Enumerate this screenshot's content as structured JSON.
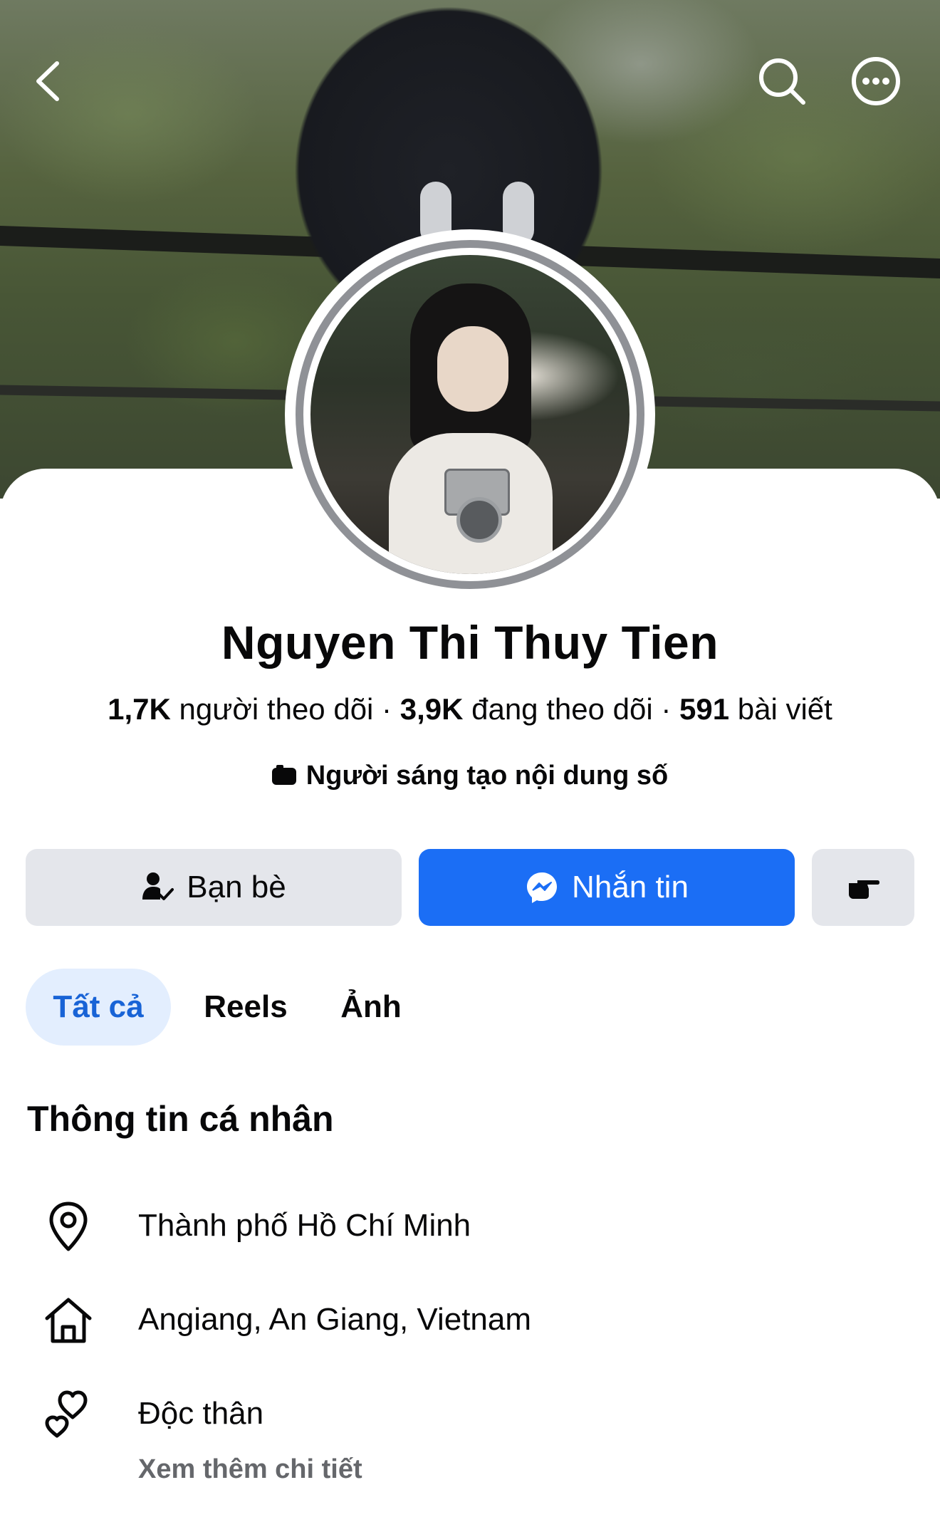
{
  "header": {
    "back_icon": "chevron-left-icon",
    "search_icon": "search-icon",
    "more_icon": "more-horizontal-icon"
  },
  "profile": {
    "name": "Nguyen Thi Thuy Tien",
    "followers_count": "1,7K",
    "followers_label": " người theo dõi · ",
    "following_count": "3,9K",
    "following_label": " đang theo dõi · ",
    "posts_count": "591",
    "posts_label": " bài viết",
    "category": "Người sáng tạo nội dung số"
  },
  "actions": {
    "friends_label": "Bạn bè",
    "message_label": "Nhắn tin",
    "wave_icon": "poke-hand-icon"
  },
  "tabs": [
    {
      "label": "Tất cả",
      "active": true
    },
    {
      "label": "Reels",
      "active": false
    },
    {
      "label": "Ảnh",
      "active": false
    }
  ],
  "about": {
    "title": "Thông tin cá nhân",
    "items": [
      {
        "icon": "location-pin-icon",
        "text": "Thành phố Hồ Chí Minh"
      },
      {
        "icon": "home-icon",
        "text": "Angiang, An Giang, Vietnam"
      },
      {
        "icon": "hearts-icon",
        "text": "Độc thân"
      }
    ],
    "see_more": "Xem thêm chi tiết"
  },
  "colors": {
    "primary_blue": "#1b6ef5",
    "tab_active_bg": "#e3eefe",
    "tab_active_text": "#1863d6",
    "secondary_button_bg": "#e4e6eb",
    "muted_text": "#65676b"
  }
}
